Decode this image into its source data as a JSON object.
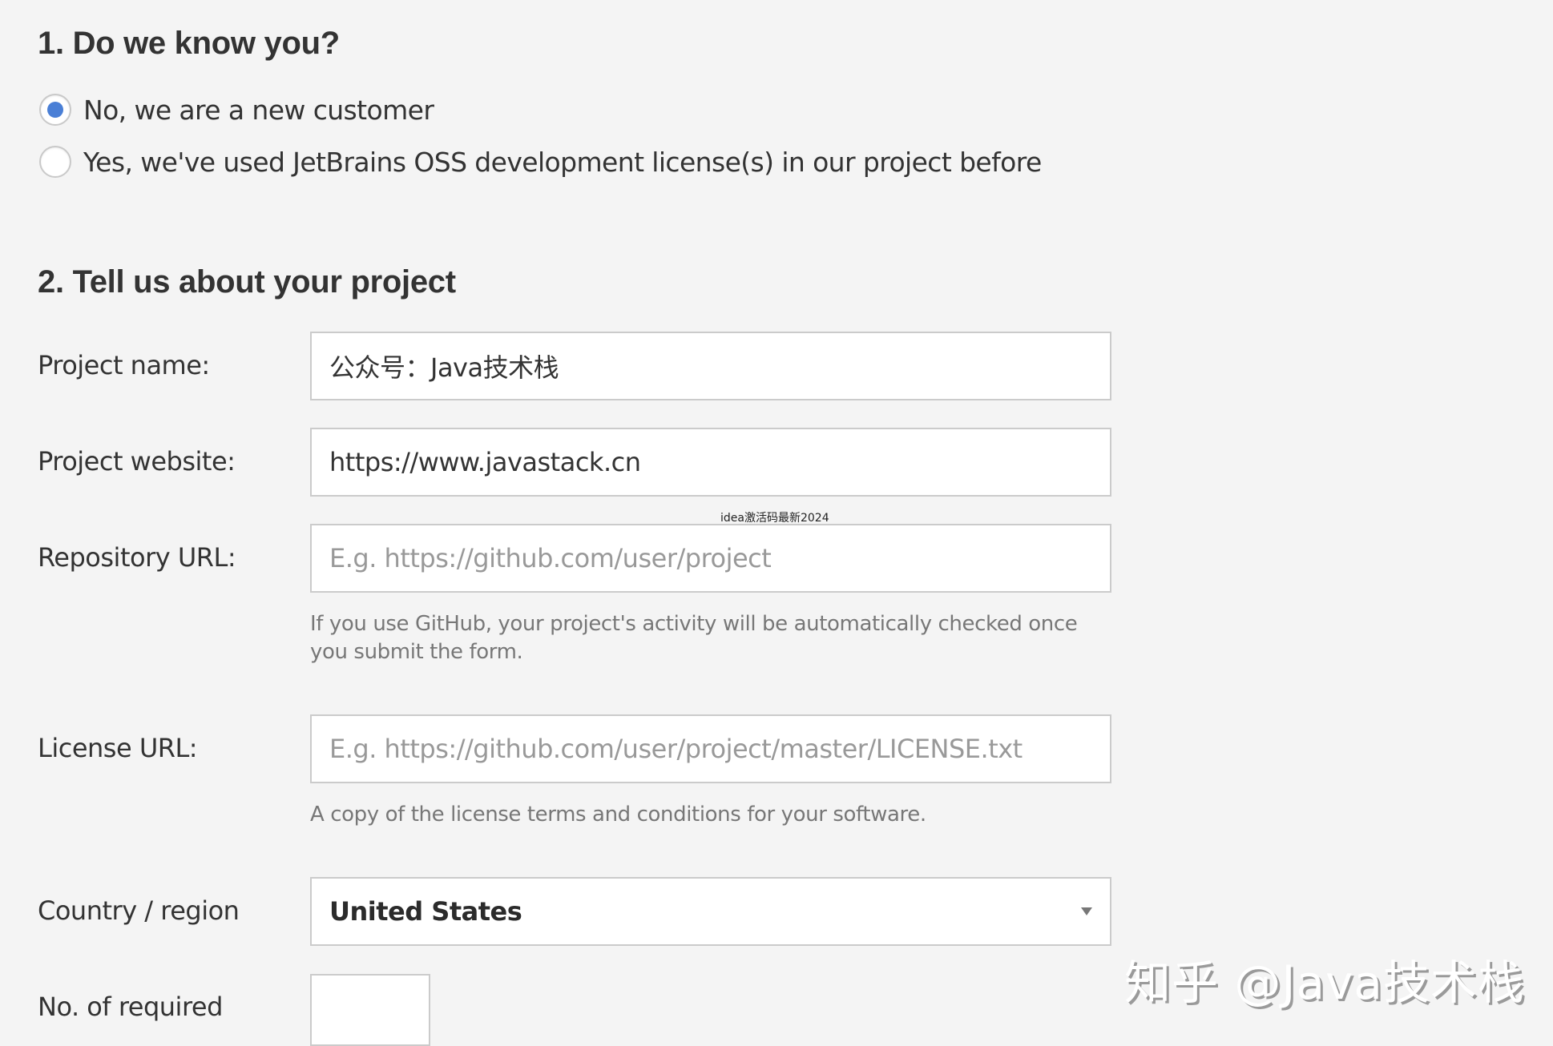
{
  "section1": {
    "title": "1.  Do we know you?",
    "options": [
      {
        "label": "No, we are a new customer",
        "checked": true
      },
      {
        "label": "Yes, we've used JetBrains OSS development license(s) in our project before",
        "checked": false
      }
    ]
  },
  "section2": {
    "title": "2.  Tell us about your project",
    "project_name": {
      "label": "Project name:",
      "value": "公众号：Java技术栈"
    },
    "project_website": {
      "label": "Project website:",
      "value": "https://www.javastack.cn"
    },
    "repository_url": {
      "label": "Repository URL:",
      "value": "",
      "placeholder": "E.g. https://github.com/user/project",
      "help": "If you use GitHub, your project's activity will be automatically checked once you submit the form."
    },
    "license_url": {
      "label": "License URL:",
      "value": "",
      "placeholder": "E.g. https://github.com/user/project/master/LICENSE.txt",
      "help": "A copy of the license terms and conditions for your software."
    },
    "country": {
      "label": "Country / region",
      "selected": "United States"
    },
    "required_licenses": {
      "label": "No. of required",
      "value": ""
    }
  },
  "overlay_note": "idea激活码最新2024",
  "watermark": "知乎 @Java技术栈",
  "colors": {
    "accent": "#4a7fd6",
    "background": "#f4f4f4",
    "border": "#cbcbcb",
    "placeholder": "#999999"
  }
}
